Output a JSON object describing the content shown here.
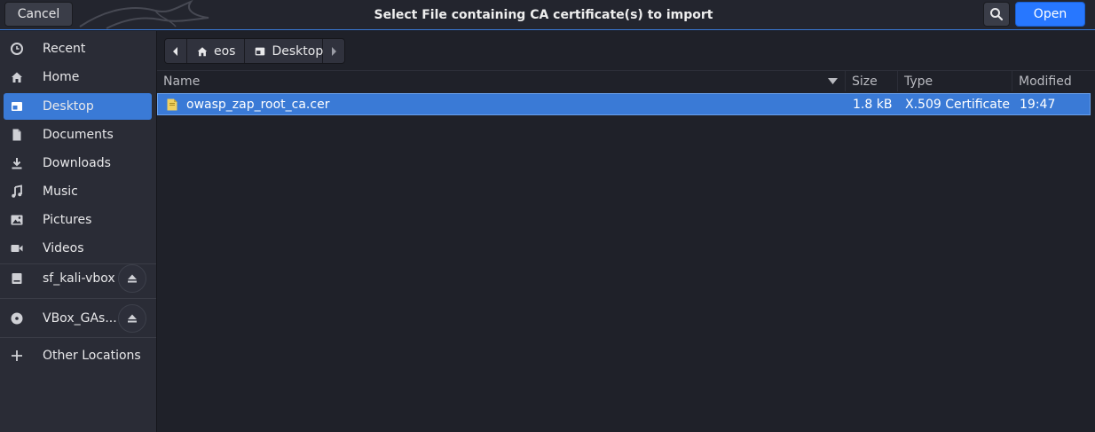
{
  "header": {
    "cancel_label": "Cancel",
    "title": "Select File containing CA certificate(s) to import",
    "open_label": "Open"
  },
  "sidebar": {
    "items": [
      {
        "label": "Recent",
        "icon": "clock-icon"
      },
      {
        "label": "Home",
        "icon": "home-icon"
      },
      {
        "label": "Desktop",
        "icon": "desktop-icon",
        "active": true
      },
      {
        "label": "Documents",
        "icon": "document-icon"
      },
      {
        "label": "Downloads",
        "icon": "download-icon"
      },
      {
        "label": "Music",
        "icon": "music-icon"
      },
      {
        "label": "Pictures",
        "icon": "picture-icon"
      },
      {
        "label": "Videos",
        "icon": "video-icon"
      },
      {
        "label": "sf_kali-vbox",
        "icon": "drive-icon"
      },
      {
        "label": "VBox_GAs...",
        "icon": "disc-icon"
      },
      {
        "label": "Other Locations",
        "icon": "plus-icon"
      }
    ]
  },
  "pathbar": {
    "segments": [
      "eos",
      "Desktop"
    ]
  },
  "table": {
    "columns": [
      "Name",
      "Size",
      "Type",
      "Modified"
    ],
    "rows": [
      {
        "name": "owasp_zap_root_ca.cer",
        "size": "1.8 kB",
        "type": "X.509 Certificate",
        "modified": "19:47"
      }
    ]
  },
  "colors": {
    "accent": "#3a7ad6",
    "open_button": "#2777ff",
    "background": "#1f2129",
    "sidebar": "#2a2c36"
  }
}
